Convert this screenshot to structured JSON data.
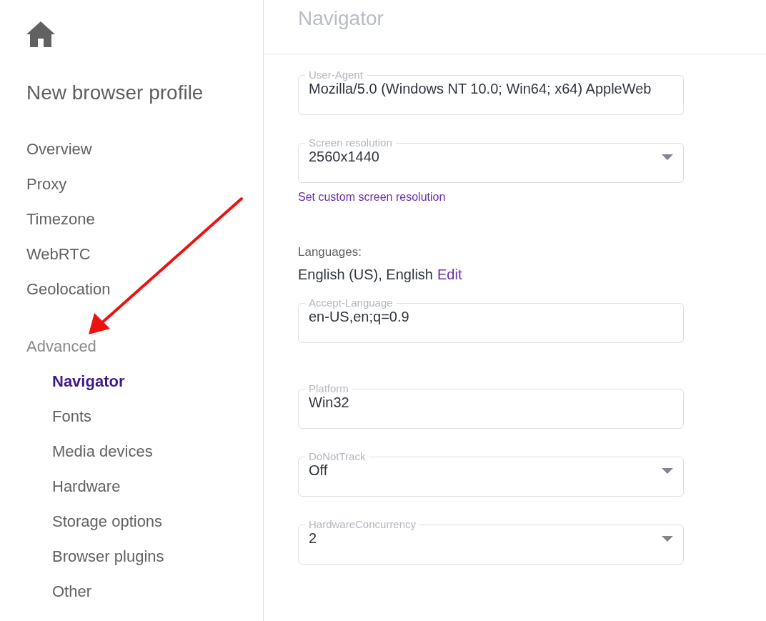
{
  "sidebar": {
    "title": "New browser profile",
    "items": [
      {
        "label": "Overview",
        "selected": false
      },
      {
        "label": "Proxy",
        "selected": false
      },
      {
        "label": "Timezone",
        "selected": false
      },
      {
        "label": "WebRTC",
        "selected": false
      },
      {
        "label": "Geolocation",
        "selected": false
      }
    ],
    "section": {
      "label": "Advanced",
      "children": [
        {
          "label": "Navigator",
          "selected": true
        },
        {
          "label": "Fonts",
          "selected": false
        },
        {
          "label": "Media devices",
          "selected": false
        },
        {
          "label": "Hardware",
          "selected": false
        },
        {
          "label": "Storage options",
          "selected": false
        },
        {
          "label": "Browser plugins",
          "selected": false
        },
        {
          "label": "Other",
          "selected": false
        }
      ]
    }
  },
  "header": {
    "title": "Navigator"
  },
  "form": [
    {
      "kind": "input",
      "label": "User-Agent",
      "value": "Mozilla/5.0 (Windows NT 10.0; Win64; x64) AppleWeb"
    },
    {
      "kind": "select",
      "label": "Screen resolution",
      "value": "2560x1440",
      "link": "Set custom screen resolution"
    },
    {
      "kind": "languages",
      "label": "Languages:",
      "value": "English (US), English",
      "link": "Edit",
      "field": {
        "label": "Accept-Language",
        "value": "en-US,en;q=0.9"
      }
    },
    {
      "kind": "input",
      "label": "Platform",
      "value": "Win32"
    },
    {
      "kind": "select",
      "label": "DoNotTrack",
      "value": "Off"
    },
    {
      "kind": "select",
      "label": "HardwareConcurrency",
      "value": "2"
    }
  ]
}
